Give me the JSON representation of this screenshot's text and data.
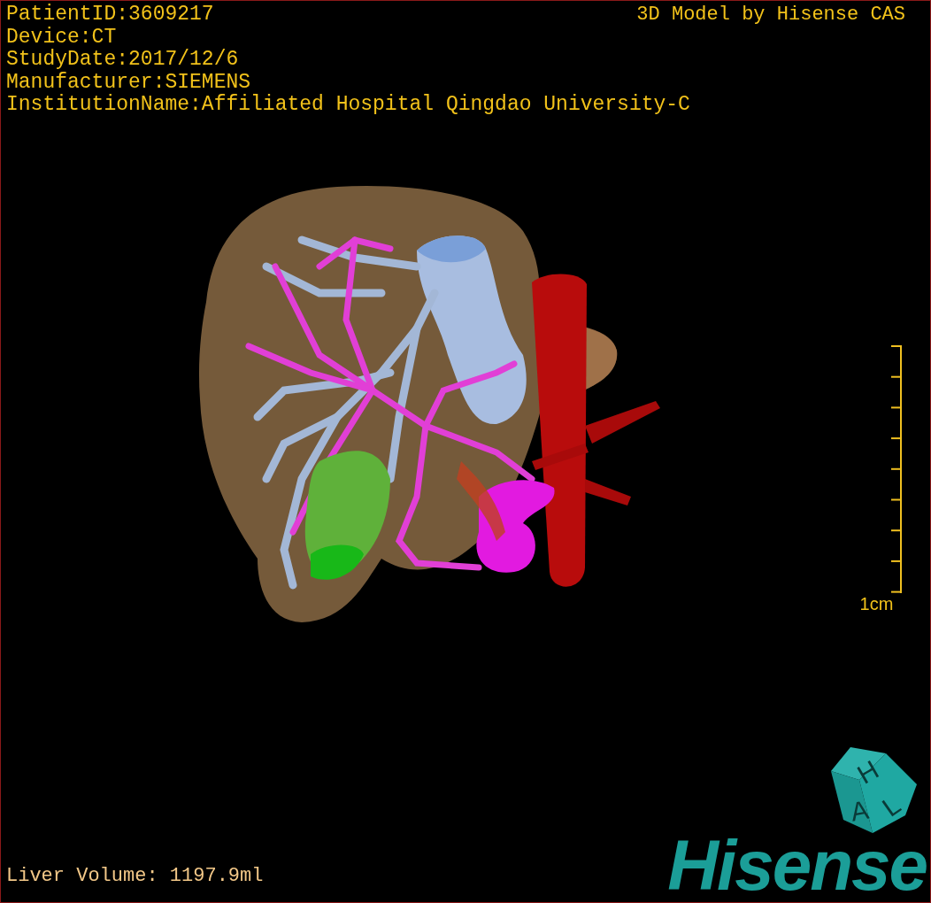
{
  "overlay": {
    "patient_info": [
      "PatientID:3609217",
      "Device:CT",
      "StudyDate:2017/12/6",
      "Manufacturer:SIEMENS",
      "InstitutionName:Affiliated Hospital Qingdao University-C"
    ],
    "title": "3D Model by Hisense CAS",
    "scale_bar": {
      "label": "1cm"
    },
    "liver_volume": "Liver Volume: 1197.9ml"
  },
  "logo": {
    "cube_letters": [
      "H",
      "A",
      "L"
    ],
    "wordmark": "Hisense"
  }
}
